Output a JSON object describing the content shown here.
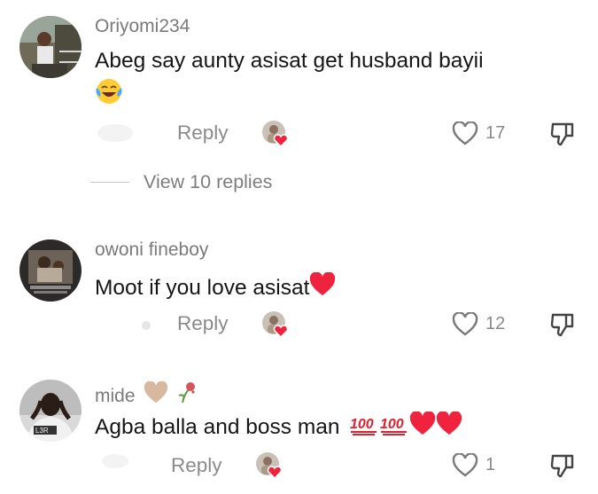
{
  "comments": [
    {
      "username": "Oriyomi234",
      "text": "Abeg say aunty asisat get husband bayii",
      "emojis": [
        "face-with-tears-of-joy"
      ],
      "reply_label": "Reply",
      "like_count": "17",
      "liked_by_creator": true
    },
    {
      "username": "owoni fineboy",
      "text": "Moot if you love asisat",
      "emojis": [
        "red-heart"
      ],
      "reply_label": "Reply",
      "like_count": "12",
      "liked_by_creator": true
    },
    {
      "username": "mide",
      "username_emojis": [
        "light-brown-heart",
        "wilted-flower"
      ],
      "text": "Agba balla and boss man",
      "emojis": [
        "hundred-points",
        "hundred-points",
        "red-heart",
        "red-heart"
      ],
      "reply_label": "Reply",
      "like_count": "1",
      "liked_by_creator": true
    }
  ],
  "view_replies_label": "View 10 replies",
  "colors": {
    "text": "#161616",
    "muted": "#8a8a8a",
    "heart_red": "#f0233f",
    "hundred_red": "#e0202f"
  }
}
